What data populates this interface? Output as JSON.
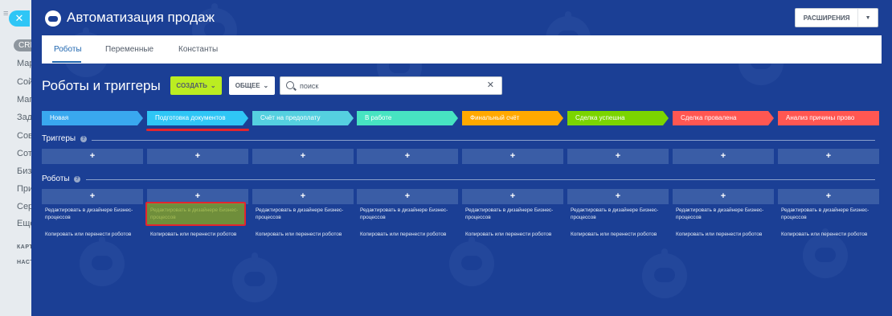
{
  "sidebar": {
    "tag": "CRM",
    "items": [
      "Мар",
      "Сойт",
      "Мага",
      "Зада",
      "Совм",
      "Сотр",
      "Бизн",
      "Прил",
      "Серв",
      "Ещё"
    ],
    "sections": [
      "КАРТА",
      "НАСТ"
    ]
  },
  "header": {
    "title": "Автоматизация продаж",
    "extensions_label": "РАСШИРЕНИЯ"
  },
  "tabs": [
    {
      "label": "Роботы",
      "active": true
    },
    {
      "label": "Переменные",
      "active": false
    },
    {
      "label": "Константы",
      "active": false
    }
  ],
  "toolbar": {
    "section_title": "Роботы и триггеры",
    "create_label": "СОЗДАТЬ",
    "filter_label": "ОБЩЕЕ",
    "search_value": "поиск"
  },
  "stages": [
    {
      "name": "Новая",
      "color": "#39a8ef"
    },
    {
      "name": "Подготовка документов",
      "color": "#2fc6f6"
    },
    {
      "name": "Счёт на предоплату",
      "color": "#55d0e0"
    },
    {
      "name": "В работе",
      "color": "#47e4c2"
    },
    {
      "name": "Финальный счёт",
      "color": "#ffa900"
    },
    {
      "name": "Сделка успешна",
      "color": "#7bd500"
    },
    {
      "name": "Сделка провалена",
      "color": "#ff5752"
    },
    {
      "name": "Анализ причины прово",
      "color": "#ff5752"
    }
  ],
  "triggers_section": {
    "label": "Триггеры"
  },
  "robots_section": {
    "label": "Роботы"
  },
  "add_symbol": "+",
  "column_links": {
    "edit": "Редактировать в дизайнере Бизнес-процессов",
    "copy": "Копировать или перенести роботов"
  }
}
